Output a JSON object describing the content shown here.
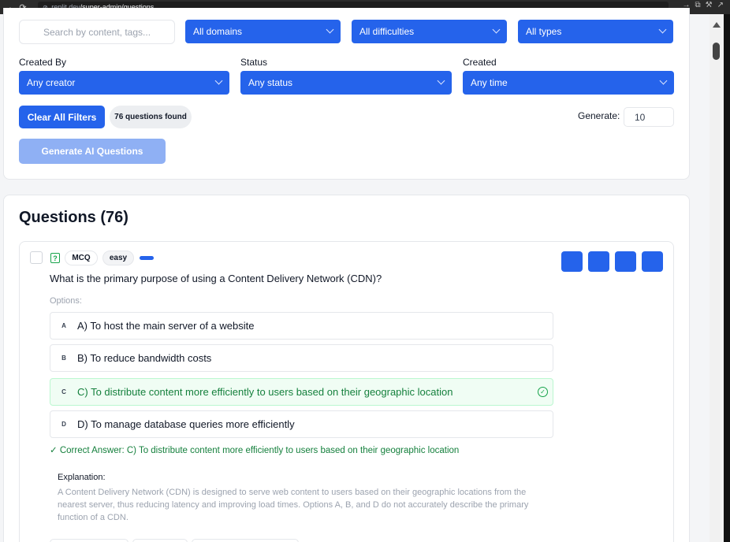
{
  "browser": {
    "url_host": ".replit.dev",
    "url_path": "/super-admin/questions"
  },
  "filters": {
    "search_placeholder": "Search by content, tags...",
    "domain_select": "All domains",
    "difficulty_select": "All difficulties",
    "type_select": "All types",
    "created_by_label": "Created By",
    "creator_select": "Any creator",
    "status_label": "Status",
    "status_select": "Any status",
    "created_label": "Created",
    "created_select": "Any time",
    "clear_button": "Clear All Filters",
    "count_badge": "76 questions found",
    "generate_label": "Generate:",
    "generate_value": "10",
    "generate_ai_button": "Generate AI Questions"
  },
  "questions": {
    "heading": "Questions (76)",
    "item": {
      "type_tag": "MCQ",
      "difficulty_tag": "easy",
      "text": "What is the primary purpose of using a Content Delivery Network (CDN)?",
      "options_label": "Options:",
      "options": [
        {
          "letter": "A",
          "text": "A) To host the main server of a website",
          "correct": false
        },
        {
          "letter": "B",
          "text": "B) To reduce bandwidth costs",
          "correct": false
        },
        {
          "letter": "C",
          "text": "C) To distribute content more efficiently to users based on their geographic location",
          "correct": true
        },
        {
          "letter": "D",
          "text": "D) To manage database queries more efficiently",
          "correct": false
        }
      ],
      "correct_answer": "✓ Correct Answer: C) To distribute content more efficiently to users based on their geographic location",
      "explanation_label": "Explanation:",
      "explanation_text": "A Content Delivery Network (CDN) is designed to serve web content to users based on their geographic locations from the nearest server, thus reducing latency and improving load times. Options A, B, and D do not accurately describe the primary function of a CDN."
    }
  },
  "colors": {
    "accent": "#2563eb",
    "success": "#15803d"
  }
}
